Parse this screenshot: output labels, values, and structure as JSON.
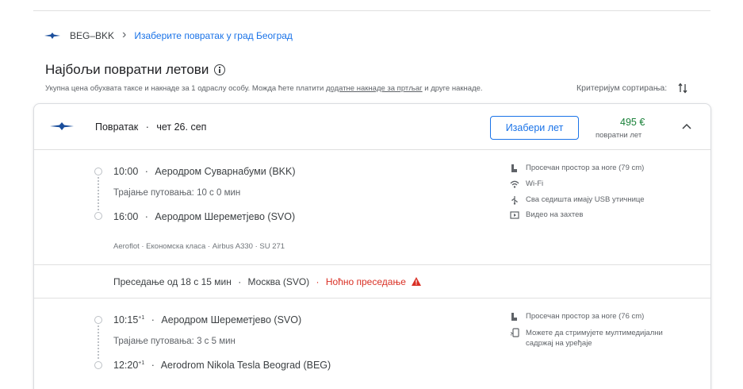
{
  "breadcrumb": {
    "route": "BEG–BKK",
    "chevron": "›",
    "link": "Изаберите повратак у град Београд"
  },
  "heading": {
    "title": "Најбољи повратни летови",
    "info_icon": "info-icon"
  },
  "subtext": {
    "part1": "Укупна цена обухвата таксе и накнаде за 1 одраслу особу. Можда ћете платити ",
    "link": "додатне накнаде за пртљаг",
    "part2": " и друге накнаде."
  },
  "sort": {
    "label": "Критеријум сортирања:",
    "icon": "sort-icon"
  },
  "card": {
    "header": {
      "direction": "Повратак",
      "separator": "·",
      "date": "чет 26. сеп",
      "select_label": "Изабери лет",
      "price": "495 €",
      "price_label": "повратни лет"
    },
    "segments": [
      {
        "dep_time": "10:00",
        "dep_sup": "",
        "dep_airport": "Аеродром Суварнабуми (BKK)",
        "duration": "Трајање путовања: 10 с 0 мин",
        "arr_time": "16:00",
        "arr_sup": "",
        "arr_airport": "Аеродром Шереметјево (SVO)",
        "meta": "Aeroflot  ·  Економска класа  ·  Airbus A330  ·  SU 271",
        "amenities": [
          {
            "icon": "legroom-icon",
            "text": "Просечан простор за ноге (79 cm)"
          },
          {
            "icon": "wifi-icon",
            "text": "Wi-Fi"
          },
          {
            "icon": "usb-icon",
            "text": "Сва седишта имају USB утичнице"
          },
          {
            "icon": "video-icon",
            "text": "Видео на захтев"
          }
        ]
      },
      {
        "dep_time": "10:15",
        "dep_sup": "+1",
        "dep_airport": "Аеродром Шереметјево (SVO)",
        "duration": "Трајање путовања: 3 с 5 мин",
        "arr_time": "12:20",
        "arr_sup": "+1",
        "arr_airport": "Aerodrom Nikola Tesla Beograd (BEG)",
        "amenities": [
          {
            "icon": "legroom-icon",
            "text": "Просечан простор за ноге (76 cm)"
          },
          {
            "icon": "stream-icon",
            "text": "Можете да стримујете мултимедијални садржај на уређаје"
          }
        ]
      }
    ],
    "layover": {
      "text": "Преседање од 18 с 15 мин",
      "separator": "·",
      "city": "Москва (SVO)",
      "warning": "Ноћно преседање",
      "warning_icon": "warning-icon"
    }
  },
  "colors": {
    "accent": "#1a73e8",
    "price": "#188038",
    "warning": "#d93025"
  }
}
